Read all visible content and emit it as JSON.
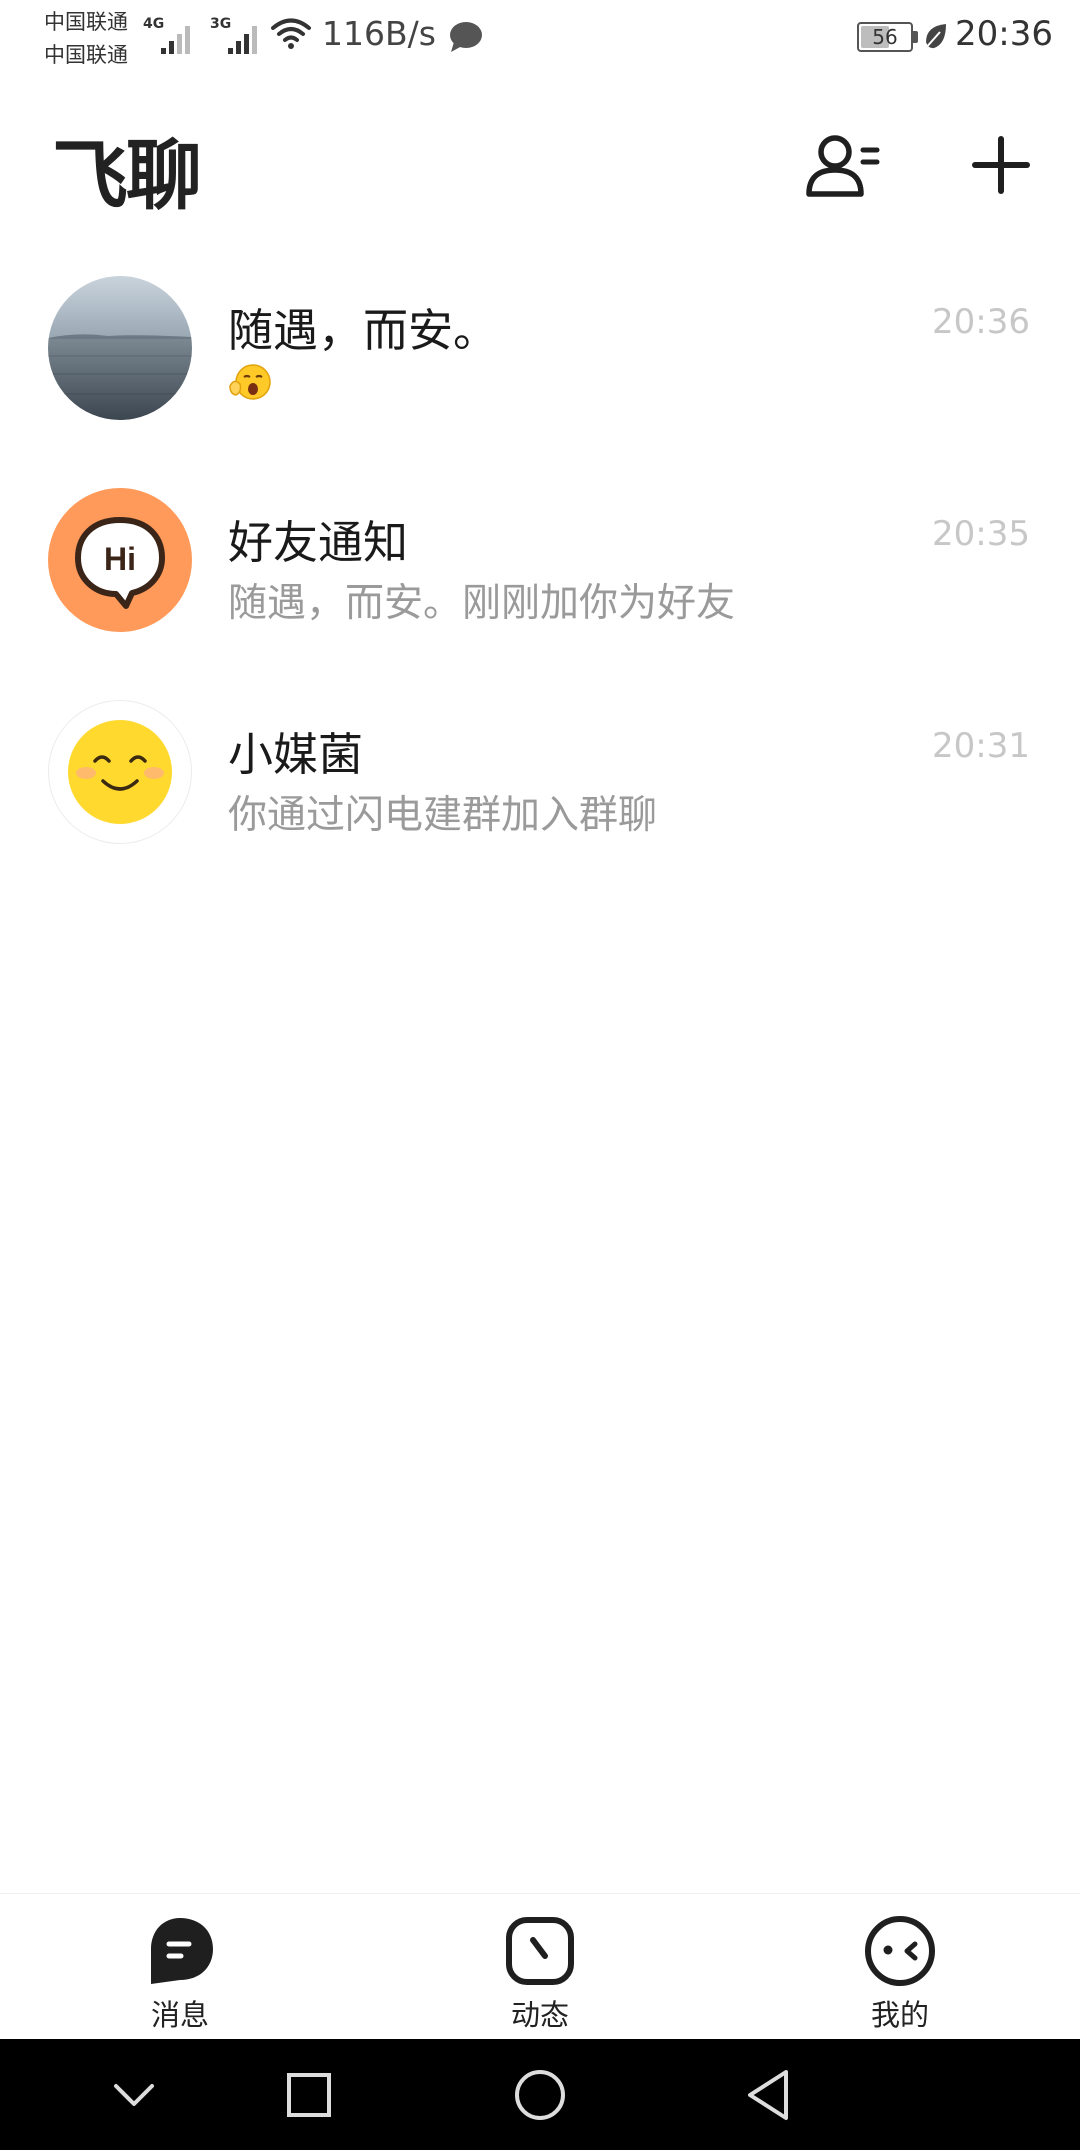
{
  "status_bar": {
    "carrier_1": "中国联通",
    "carrier_2": "中国联通",
    "network_1": "4G",
    "network_2": "3G",
    "net_speed": "116B/s",
    "battery_level": "56",
    "time": "20:36"
  },
  "header": {
    "title": "飞聊"
  },
  "chats": [
    {
      "name": "随遇，而安。",
      "preview_emoji": "yawning-face-emoji",
      "time": "20:36"
    },
    {
      "name": "好友通知",
      "preview": "随遇，而安。刚刚加你为好友",
      "time": "20:35",
      "avatar_text": "Hi"
    },
    {
      "name": "小媒菌",
      "preview": "你通过闪电建群加入群聊",
      "time": "20:31"
    }
  ],
  "tabs": {
    "messages": "消息",
    "moments": "动态",
    "me": "我的"
  },
  "colors": {
    "accent_orange": "#ff9a5a",
    "avatar_yellow": "#ffd92e",
    "icon_dark": "#1f1f1f",
    "muted_text": "#9a9a9a",
    "time_text": "#c7c7c7"
  }
}
